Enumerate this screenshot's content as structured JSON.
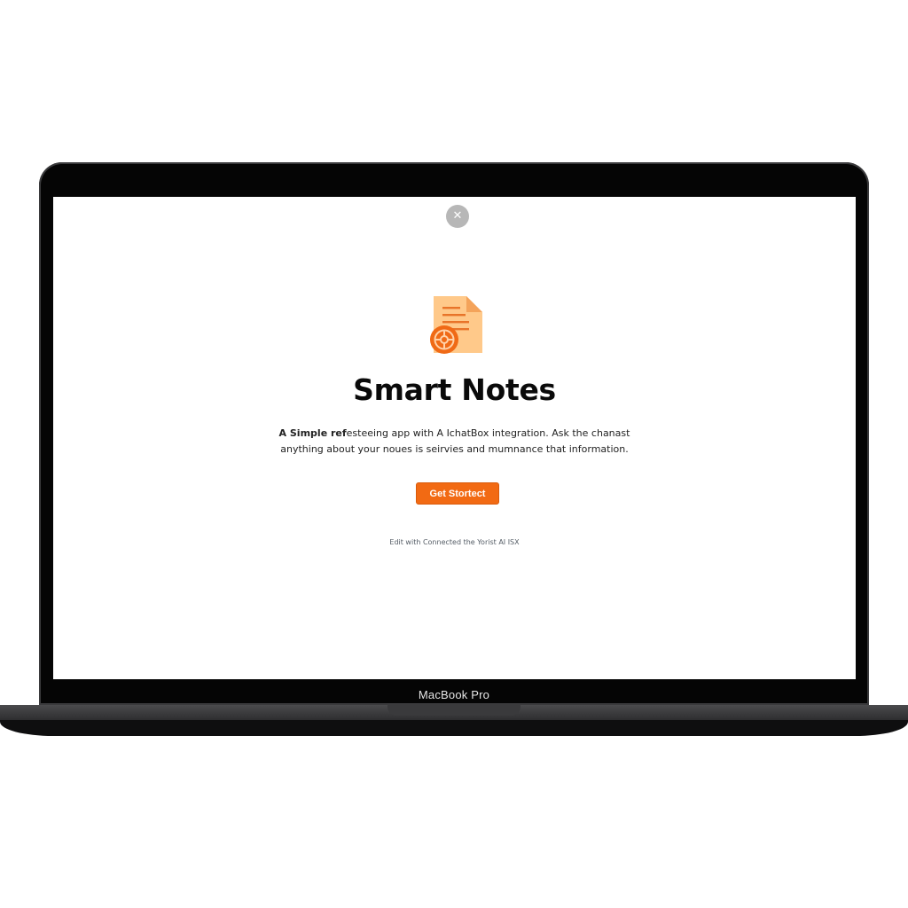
{
  "device": {
    "model_label": "MacBook Pro"
  },
  "dialog": {
    "close_icon": "close-icon",
    "app_icon": "document-gear-icon",
    "title": "Smart Notes",
    "description_bold": "A Simple ref",
    "description_rest_line1": "esteeing app with A IchatBox integration. Ask the chanast",
    "description_line2": "anything about your noues is seirvies and mumnance that information.",
    "cta_label": "Get Stortect",
    "footer_note": "Edit with Connected the Yorist AI ISX"
  },
  "colors": {
    "accent": "#f26a13",
    "icon_paper": "#ffc98a",
    "icon_badge": "#f06a16",
    "close_bg": "#b7b7b7",
    "bezel": "#050505"
  }
}
